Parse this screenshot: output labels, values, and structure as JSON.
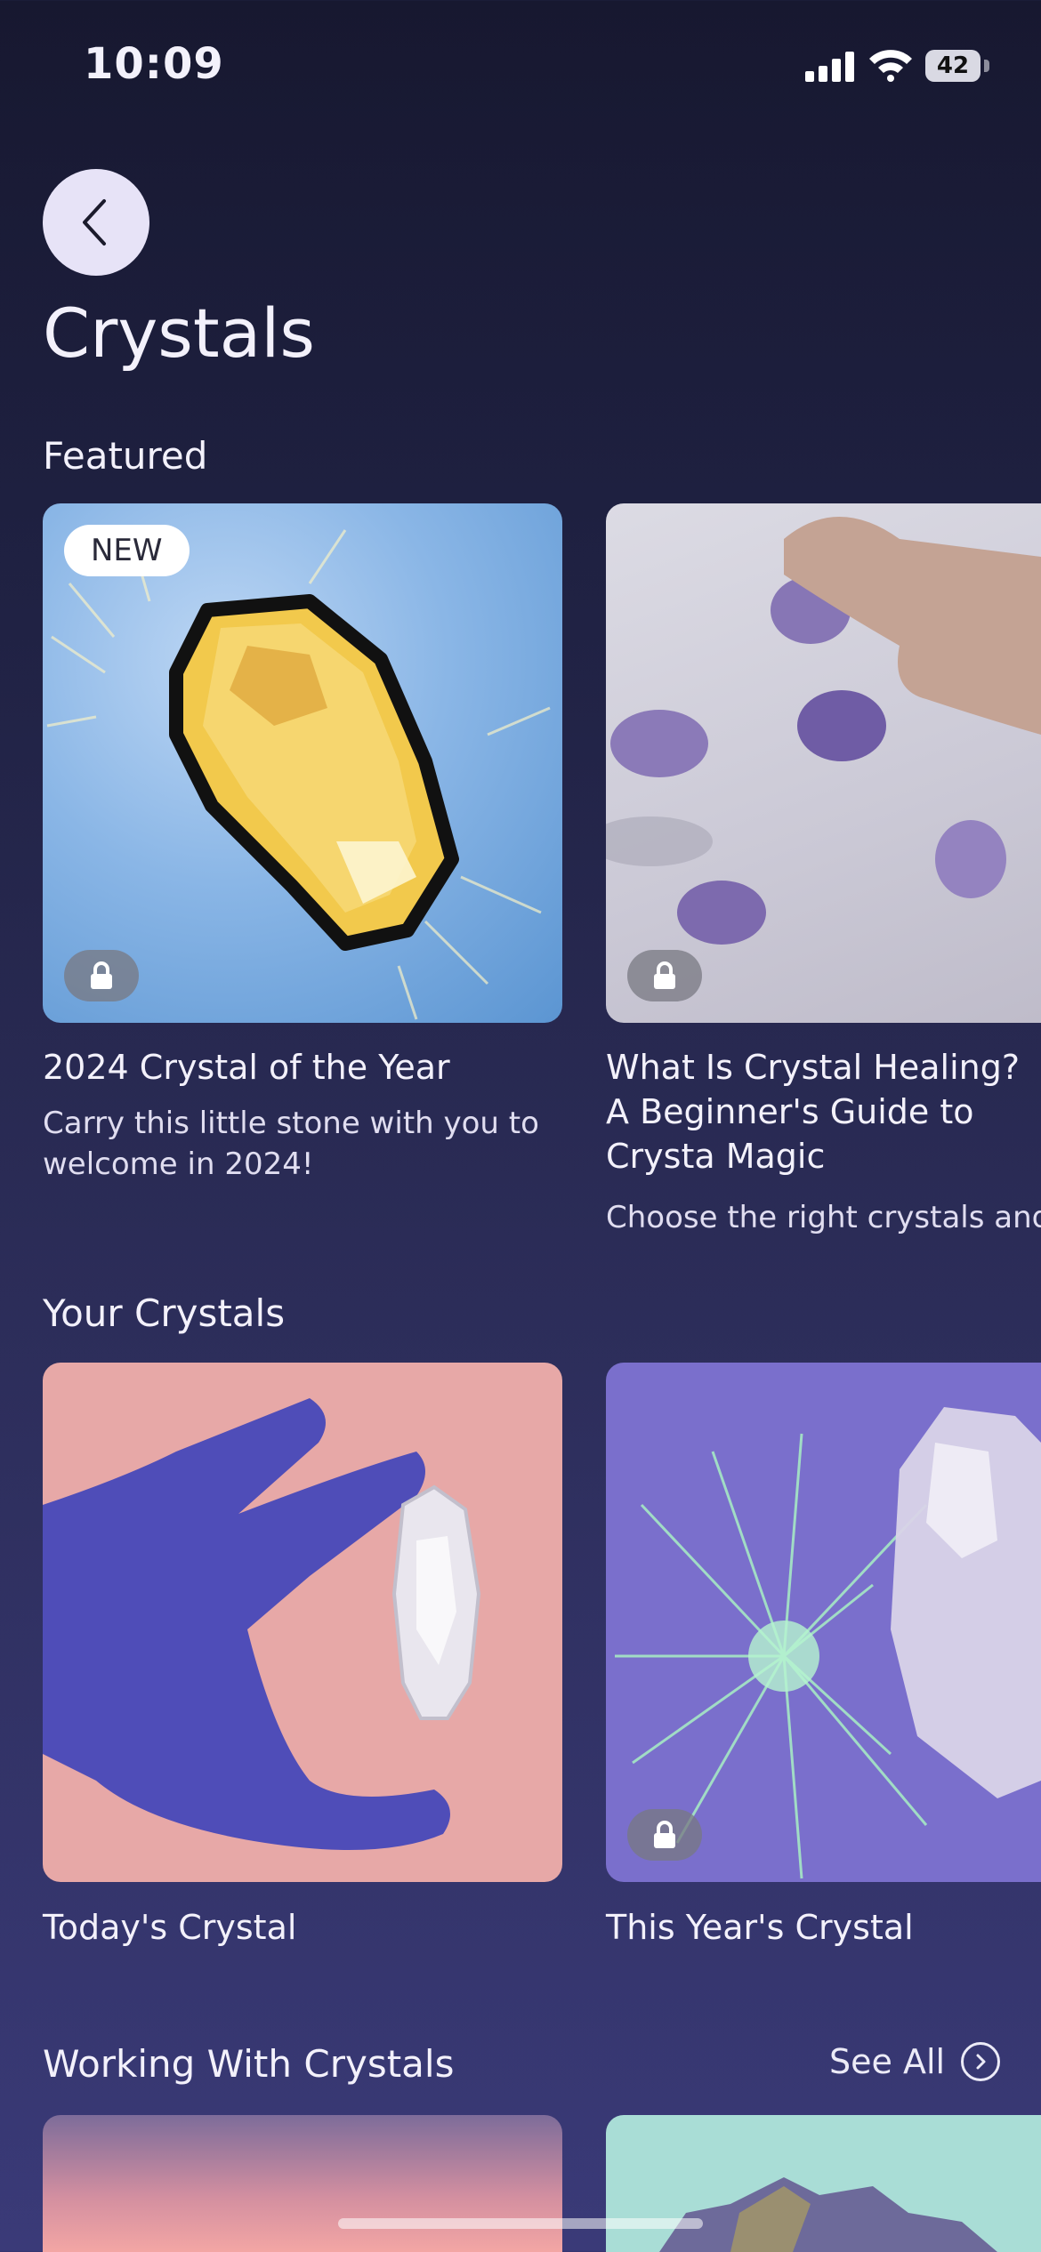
{
  "status_bar": {
    "time": "10:09",
    "battery": "42"
  },
  "page": {
    "title": "Crystals"
  },
  "featured": {
    "title": "Featured",
    "cards": [
      {
        "badge": "NEW",
        "title": "2024 Crystal of the Year",
        "subtitle": "Carry this little stone with you to welcome in 2024!",
        "locked": true
      },
      {
        "title": "What Is Crystal Healing? A Beginner's Guide to Crysta Magic",
        "subtitle": "Choose the right crystals and",
        "locked": true
      }
    ]
  },
  "your_crystals": {
    "title": "Your Crystals",
    "cards": [
      {
        "title": "Today's Crystal",
        "locked": false
      },
      {
        "title": "This Year's Crystal",
        "locked": true
      }
    ]
  },
  "working": {
    "title": "Working With Crystals",
    "see_all": "See All"
  },
  "colors": {
    "accent_back": "#e7e3f7",
    "background_top": "#171830",
    "background_bottom": "#3a3a78"
  }
}
